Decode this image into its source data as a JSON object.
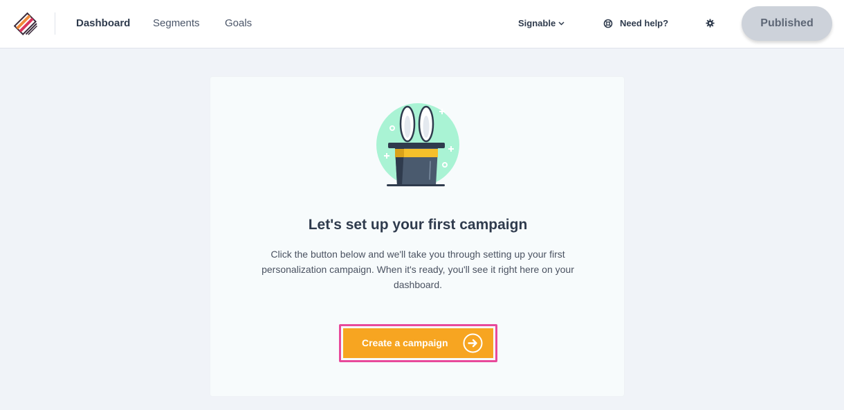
{
  "header": {
    "nav": [
      {
        "label": "Dashboard",
        "active": true
      },
      {
        "label": "Segments",
        "active": false
      },
      {
        "label": "Goals",
        "active": false
      }
    ],
    "account_label": "Signable",
    "help_label": "Need help?",
    "publish_label": "Published",
    "icons": [
      "logo-icon",
      "chevron-down-icon",
      "lifebuoy-icon",
      "gear-icon"
    ]
  },
  "empty_state": {
    "illustration": "magic-hat-rabbit-icon",
    "title": "Let's set up your first campaign",
    "description_lines": [
      "Click the button below and we'll take you through setting up your first",
      "personalization campaign. When it's ready, you'll see it right here on your",
      "dashboard."
    ],
    "cta_label": "Create a campaign",
    "cta_icon": "arrow-right-circle-icon"
  },
  "colors": {
    "accent": "#f7a521",
    "highlight_outline": "#e8499a",
    "illustration_bg": "#a9f3d4",
    "published_bg": "#cdd2da"
  }
}
